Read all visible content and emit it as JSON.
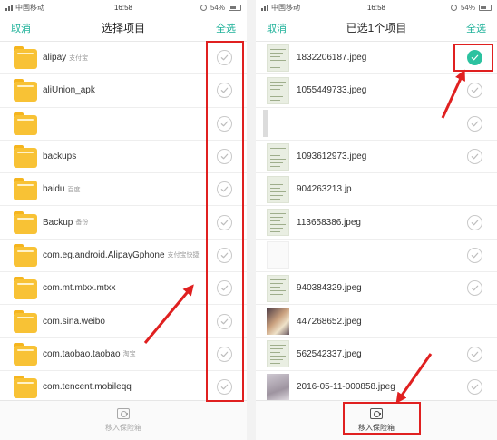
{
  "left": {
    "status": {
      "carrier": "中国移动",
      "time": "16:58",
      "battery": "54%"
    },
    "nav": {
      "cancel": "取消",
      "title": "选择项目",
      "select_all": "全选"
    },
    "items": [
      {
        "name": "alipay",
        "sub": "支付宝",
        "checked": false
      },
      {
        "name": "aliUnion_apk",
        "sub": "",
        "checked": false
      },
      {
        "name": "",
        "sub": "",
        "checked": false
      },
      {
        "name": "backups",
        "sub": "",
        "checked": false
      },
      {
        "name": "baidu",
        "sub": "百度",
        "checked": false
      },
      {
        "name": "Backup",
        "sub": "备份",
        "checked": false
      },
      {
        "name": "com.eg.android.AlipayGphone",
        "sub": "支付宝快捷",
        "checked": false
      },
      {
        "name": "com.mt.mtxx.mtxx",
        "sub": "",
        "checked": false
      },
      {
        "name": "com.sina.weibo",
        "sub": "",
        "checked": false
      },
      {
        "name": "com.taobao.taobao",
        "sub": "淘宝",
        "checked": false
      },
      {
        "name": "com.tencent.mobileqq",
        "sub": "",
        "checked": false
      }
    ],
    "bottom": {
      "label": "移入保险箱",
      "icon": "safe-icon"
    }
  },
  "right": {
    "status": {
      "carrier": "中国移动",
      "time": "16:58",
      "battery": "54%"
    },
    "nav": {
      "cancel": "取消",
      "title": "已选1个项目",
      "select_all": "全选"
    },
    "items": [
      {
        "name": "1832206187.jpeg",
        "thumb": "doc",
        "checked": true,
        "checkbox": true
      },
      {
        "name": "1055449733.jpeg",
        "thumb": "doc",
        "checked": false,
        "checkbox": true
      },
      {
        "name": "",
        "thumb": "side",
        "checked": false,
        "checkbox": true
      },
      {
        "name": "1093612973.jpeg",
        "thumb": "doc",
        "checked": false,
        "checkbox": true
      },
      {
        "name": "904263213.jp",
        "thumb": "doc",
        "checked": false,
        "checkbox": false
      },
      {
        "name": "113658386.jpeg",
        "thumb": "doc",
        "checked": false,
        "checkbox": true
      },
      {
        "name": "",
        "thumb": "white",
        "checked": false,
        "checkbox": true
      },
      {
        "name": "940384329.jpeg",
        "thumb": "doc",
        "checked": false,
        "checkbox": true
      },
      {
        "name": "447268652.jpeg",
        "thumb": "photo",
        "checked": false,
        "checkbox": false
      },
      {
        "name": "562542337.jpeg",
        "thumb": "doc",
        "checked": false,
        "checkbox": true
      },
      {
        "name": "2016-05-11-000858.jpeg",
        "thumb": "blur",
        "checked": false,
        "checkbox": true
      }
    ],
    "bottom": {
      "label": "移入保险箱",
      "icon": "safe-icon"
    }
  },
  "colors": {
    "accent": "#1fb29a",
    "checked": "#2cc2a0",
    "annotation": "#e02020",
    "folder": "#f8c235"
  }
}
